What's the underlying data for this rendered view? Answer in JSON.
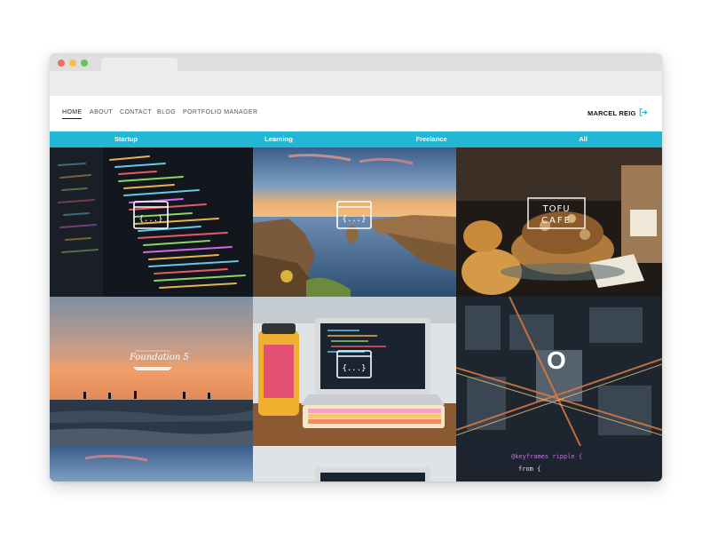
{
  "nav": {
    "links": [
      {
        "label": "HOME",
        "active": true
      },
      {
        "label": "ABOUT"
      },
      {
        "label": "CONTACT"
      },
      {
        "label": "BLOG"
      },
      {
        "label": "PORTFOLIO MANAGER"
      }
    ],
    "user_name": "MARCEL REIG",
    "logout_icon": "logout-icon"
  },
  "filters": [
    "Startup",
    "Learning",
    "Freelance",
    "All"
  ],
  "tiles": {
    "cafe_logo": "TOFU CAFE",
    "foundation_label": "Foundation 5",
    "opera_letter": "O",
    "code_line_1": "@keyframes ripple {",
    "code_line_2": "from {"
  },
  "colors": {
    "accent": "#22b7d4",
    "window_red": "#f26b5f",
    "window_yellow": "#f6bf4f",
    "window_green": "#5fc65a"
  }
}
